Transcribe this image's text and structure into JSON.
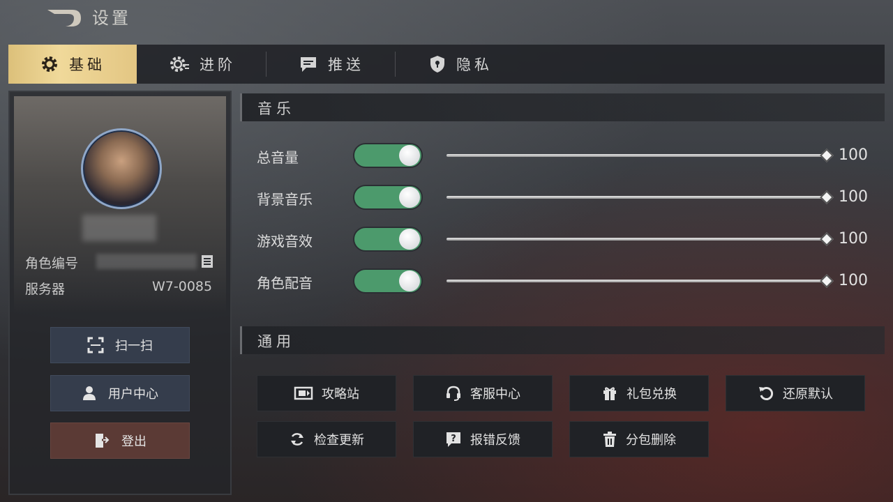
{
  "header": {
    "title": "设置"
  },
  "tabs": [
    {
      "label": "基础",
      "icon": "gear-icon",
      "active": true
    },
    {
      "label": "进阶",
      "icon": "gear-advanced-icon",
      "active": false
    },
    {
      "label": "推送",
      "icon": "message-icon",
      "active": false
    },
    {
      "label": "隐私",
      "icon": "shield-icon",
      "active": false
    }
  ],
  "profile": {
    "role_id_label": "角色编号",
    "server_label": "服务器",
    "server_value": "W7-0085",
    "buttons": {
      "scan": "扫一扫",
      "user_center": "用户中心",
      "logout": "登出"
    }
  },
  "music": {
    "section_title": "音乐",
    "items": [
      {
        "label": "总音量",
        "enabled": true,
        "value": "100"
      },
      {
        "label": "背景音乐",
        "enabled": true,
        "value": "100"
      },
      {
        "label": "游戏音效",
        "enabled": true,
        "value": "100"
      },
      {
        "label": "角色配音",
        "enabled": true,
        "value": "100"
      }
    ]
  },
  "general": {
    "section_title": "通用",
    "buttons": [
      {
        "label": "攻略站",
        "icon": "guide-icon"
      },
      {
        "label": "客服中心",
        "icon": "headset-icon"
      },
      {
        "label": "礼包兑换",
        "icon": "gift-icon"
      },
      {
        "label": "还原默认",
        "icon": "reset-icon"
      },
      {
        "label": "检查更新",
        "icon": "refresh-icon"
      },
      {
        "label": "报错反馈",
        "icon": "feedback-icon"
      },
      {
        "label": "分包删除",
        "icon": "trash-icon"
      }
    ]
  },
  "colors": {
    "accent_tab": "#e3c683",
    "toggle_on": "#4c9a6c",
    "logout": "#5b3a35",
    "button_blue": "#353d4c"
  }
}
